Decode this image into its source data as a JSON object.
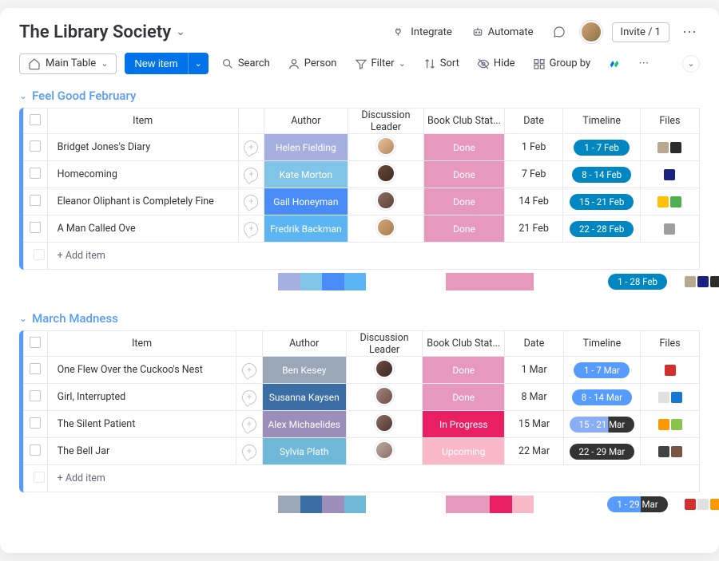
{
  "header": {
    "title": "The Library Society",
    "integrate": "Integrate",
    "automate": "Automate",
    "invite": "Invite / 1"
  },
  "toolbar": {
    "main_table": "Main Table",
    "new_item": "New item",
    "search": "Search",
    "person": "Person",
    "filter": "Filter",
    "sort": "Sort",
    "hide": "Hide",
    "group_by": "Group by"
  },
  "columns": {
    "item": "Item",
    "author": "Author",
    "leader": "Discussion Leader",
    "status": "Book Club Stat...",
    "date": "Date",
    "timeline": "Timeline",
    "files": "Files"
  },
  "add_item": "+ Add item",
  "groups": [
    {
      "name": "Feel Good February",
      "color": "#579bfc",
      "rows": [
        {
          "item": "Bridget Jones's Diary",
          "author": "Helen Fielding",
          "author_color": "#a5b0e1",
          "leader_color": "linear-gradient(135deg,#e8c39e,#b5855d)",
          "status": "Done",
          "status_color": "#e699bd",
          "date": "1 Feb",
          "timeline": "1 - 7 Feb",
          "timeline_bg": "#0086c0",
          "files": [
            "#b8a88f",
            "#2c2c2c"
          ]
        },
        {
          "item": "Homecoming",
          "author": "Kate Morton",
          "author_color": "#80c5e8",
          "leader_color": "linear-gradient(135deg,#6b4a3a,#3d2a1f)",
          "status": "Done",
          "status_color": "#e699bd",
          "date": "7 Feb",
          "timeline": "8 - 14 Feb",
          "timeline_bg": "#0086c0",
          "files": [
            "#1a237e"
          ]
        },
        {
          "item": "Eleanor Oliphant is Completely Fine",
          "author": "Gail Honeyman",
          "author_color": "#4a8cf7",
          "leader_color": "linear-gradient(135deg,#8d6e63,#5d4037)",
          "status": "Done",
          "status_color": "#e699bd",
          "date": "14 Feb",
          "timeline": "15 - 21 Feb",
          "timeline_bg": "#0086c0",
          "files": [
            "#ffc107",
            "#4caf50"
          ]
        },
        {
          "item": "A Man Called Ove",
          "author": "Fredrik Backman",
          "author_color": "#5ab5f2",
          "leader_color": "linear-gradient(135deg,#d4a574,#a67c52)",
          "status": "Done",
          "status_color": "#e699bd",
          "date": "21 Feb",
          "timeline": "22 - 28 Feb",
          "timeline_bg": "#0086c0",
          "files": [
            "#9e9e9e"
          ]
        }
      ],
      "summary": {
        "author_swatches": [
          "#a5b0e1",
          "#80c5e8",
          "#4a8cf7",
          "#5ab5f2"
        ],
        "status_swatches": [
          "#e699bd"
        ],
        "timeline": "1 - 28 Feb",
        "timeline_bg": "#0086c0",
        "file_swatches": [
          "#b8a88f",
          "#1a237e",
          "#2c2c2c",
          "#ffc107"
        ]
      }
    },
    {
      "name": "March Madness",
      "color": "#579bfc",
      "rows": [
        {
          "item": "One Flew Over the Cuckoo's Nest",
          "author": "Ben Kesey",
          "author_color": "#9aa7b8",
          "leader_color": "linear-gradient(135deg,#6d4c41,#3e2723)",
          "status": "Done",
          "status_color": "#e699bd",
          "date": "1 Mar",
          "timeline": "1 - 7 Mar",
          "timeline_bg": "#579bfc",
          "files": [
            "#d32f2f"
          ]
        },
        {
          "item": "Girl, Interrupted",
          "author": "Susanna Kaysen",
          "author_color": "#3a6ea5",
          "leader_color": "linear-gradient(135deg,#a1887f,#6d4c41)",
          "status": "Done",
          "status_color": "#e699bd",
          "date": "8 Mar",
          "timeline": "8 - 14 Mar",
          "timeline_bg": "#579bfc",
          "files": [
            "#e0e0e0",
            "#1976d2"
          ]
        },
        {
          "item": "The Silent Patient",
          "author": "Alex Michaelides",
          "author_color": "#9c8eb8",
          "leader_color": "linear-gradient(135deg,#8d6e63,#4e342e)",
          "status": "In Progress",
          "status_color": "#e91e63",
          "date": "15 Mar",
          "timeline": "15 - 21 Mar",
          "timeline_bg": "linear-gradient(90deg,#8aaef5 60%,#333 60%)",
          "files": [
            "#ff9800",
            "#8bc34a"
          ]
        },
        {
          "item": "The Bell Jar",
          "author": "Sylvia Plath",
          "author_color": "#6fb8d8",
          "leader_color": "linear-gradient(135deg,#bcaaa4,#8d6e63)",
          "status": "Upcoming",
          "status_color": "#f8b8c8",
          "date": "22 Mar",
          "timeline": "22 - 29 Mar",
          "timeline_bg": "#333333",
          "files": [
            "#424242",
            "#795548"
          ]
        }
      ],
      "summary": {
        "author_swatches": [
          "#9aa7b8",
          "#3a6ea5",
          "#9c8eb8",
          "#6fb8d8"
        ],
        "status_swatches": [
          "#e699bd",
          "#e699bd",
          "#e91e63",
          "#f8b8c8"
        ],
        "timeline": "1 - 29 Mar",
        "timeline_bg": "linear-gradient(90deg,#579bfc 55%,#333 55%)",
        "file_swatches": [
          "#d32f2f",
          "#e0e0e0",
          "#ff9800",
          "#424242"
        ]
      }
    }
  ]
}
